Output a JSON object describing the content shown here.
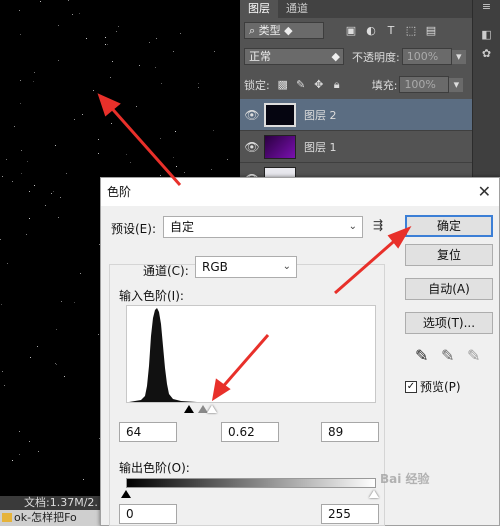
{
  "document": {
    "status_info": "文档:1.37M/2.",
    "file_tab": "ok-怎样把Fo"
  },
  "layers_panel": {
    "tabs": [
      "图层",
      "通道"
    ],
    "filter_kind": "类型",
    "blend_mode": "正常",
    "opacity_label": "不透明度:",
    "opacity_value": "100%",
    "lock_label": "锁定:",
    "fill_label": "填充:",
    "fill_value": "100%",
    "layers": [
      {
        "name": "图层 2",
        "selected": true,
        "thumb_color": "#050510"
      },
      {
        "name": "图层 1",
        "selected": false,
        "thumb_color": "#5a0a8a"
      },
      {
        "name": "",
        "selected": false,
        "thumb_color": "#e8e8ee"
      }
    ]
  },
  "levels_dialog": {
    "title": "色阶",
    "preset_label": "预设(E):",
    "preset_value": "自定",
    "channel_label": "通道(C):",
    "channel_value": "RGB",
    "input_levels_label": "输入色阶(I):",
    "input_black": "64",
    "input_gamma": "0.62",
    "input_white": "89",
    "output_levels_label": "输出色阶(O):",
    "output_black": "0",
    "output_white": "255",
    "buttons": {
      "ok": "确定",
      "reset": "复位",
      "auto": "自动(A)",
      "options": "选项(T)..."
    },
    "preview_label": "预览(P)",
    "preview_checked": true
  },
  "annotation_color": "#e8302a",
  "watermark": "Bai 经验"
}
